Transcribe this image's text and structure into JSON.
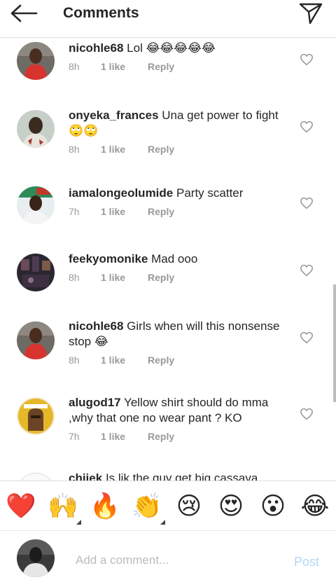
{
  "header": {
    "title": "Comments",
    "back_icon": "arrow-left-icon",
    "send_icon": "paper-plane-icon"
  },
  "comments": [
    {
      "username": "nicohle68",
      "text": "Lol 😂😂😂😂😂",
      "time": "8h",
      "likes": "1 like",
      "reply": "Reply"
    },
    {
      "username": "onyeka_frances",
      "text": "Una get power to fight 🙄🙄",
      "time": "8h",
      "likes": "1 like",
      "reply": "Reply"
    },
    {
      "username": "iamalongeolumide",
      "text": "Party scatter",
      "time": "7h",
      "likes": "1 like",
      "reply": "Reply"
    },
    {
      "username": "feekyomonike",
      "text": "Mad ooo",
      "time": "8h",
      "likes": "1 like",
      "reply": "Reply"
    },
    {
      "username": "nicohle68",
      "text": "Girls when will this nonsense stop 😂",
      "time": "8h",
      "likes": "1 like",
      "reply": "Reply"
    },
    {
      "username": "alugod17",
      "text": "Yellow shirt should do mma ,why that one no wear pant ? KO",
      "time": "7h",
      "likes": "1 like",
      "reply": "Reply"
    },
    {
      "username": "chiiek",
      "text": "Is lik the guy get big cassava",
      "time": "",
      "likes": "",
      "reply": ""
    }
  ],
  "emoji_bar": [
    "❤️",
    "🙌",
    "🔥",
    "👏",
    "😢",
    "😍",
    "😮",
    "😂"
  ],
  "input": {
    "placeholder": "Add a comment...",
    "post_label": "Post"
  },
  "colors": {
    "accent_post": "#b3d6f6",
    "meta_gray": "#999999",
    "text": "#262626"
  }
}
